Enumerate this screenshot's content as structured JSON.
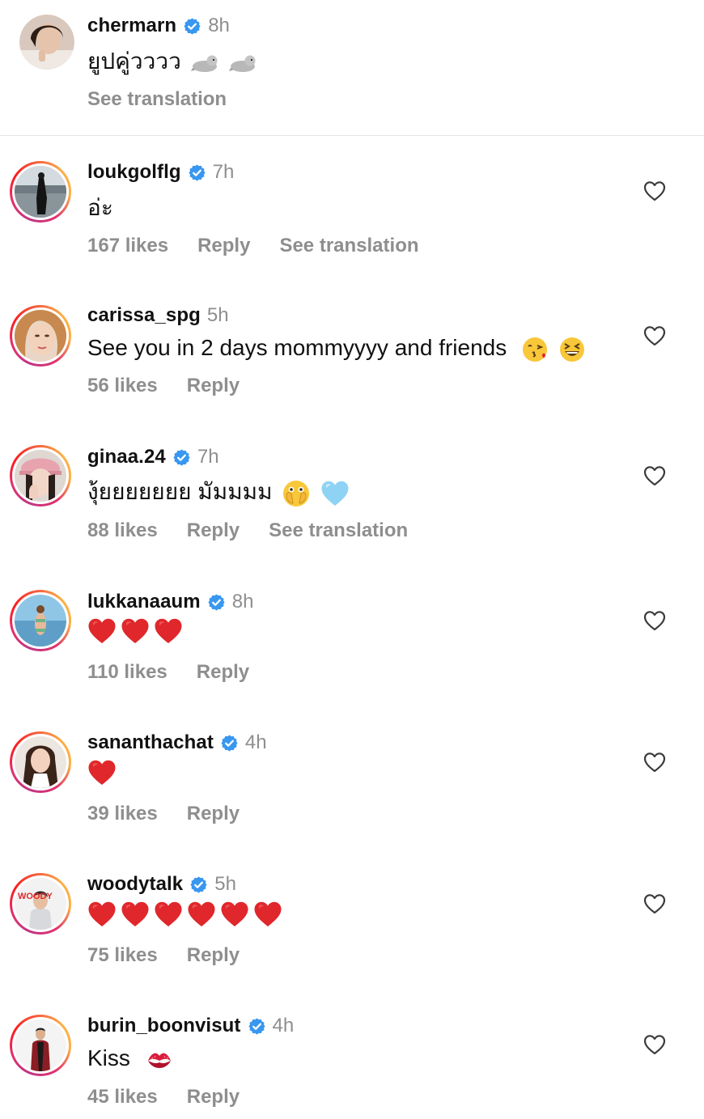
{
  "caption": {
    "username": "chermarn",
    "time": "8h",
    "text": "ยูปคู่วววว",
    "emoji": [
      "seal",
      "seal"
    ],
    "see_translation": "See translation"
  },
  "comments": [
    {
      "username": "loukgolflg",
      "verified": true,
      "time": "7h",
      "text": "อ่ะ",
      "likes": "167 likes",
      "reply": "Reply",
      "see_translation": "See translation"
    },
    {
      "username": "carissa_spg",
      "verified": false,
      "time": "5h",
      "text": "See you in 2 days mommyyyy and friends",
      "emoji": [
        "kiss-face",
        "laughing-face"
      ],
      "likes": "56 likes",
      "reply": "Reply"
    },
    {
      "username": "ginaa.24",
      "verified": true,
      "time": "7h",
      "text": "งุ้ยยยยยยย มัมมมม",
      "emoji": [
        "peeking-face",
        "light-blue-heart"
      ],
      "likes": "88 likes",
      "reply": "Reply",
      "see_translation": "See translation"
    },
    {
      "username": "lukkanaaum",
      "verified": true,
      "time": "8h",
      "emoji_count": 3,
      "likes": "110 likes",
      "reply": "Reply"
    },
    {
      "username": "sananthachat",
      "verified": true,
      "time": "4h",
      "emoji_count": 1,
      "likes": "39 likes",
      "reply": "Reply"
    },
    {
      "username": "woodytalk",
      "verified": true,
      "time": "5h",
      "emoji_count": 6,
      "likes": "75 likes",
      "reply": "Reply",
      "avatar_logo": "WOODY"
    },
    {
      "username": "burin_boonvisut",
      "verified": true,
      "time": "4h",
      "text": "Kiss",
      "emoji": [
        "kiss-mark"
      ],
      "likes": "45 likes",
      "reply": "Reply"
    }
  ],
  "colors": {
    "verified_blue": "#3897f0",
    "muted_text": "#8e8e8e",
    "heart_red": "#e0272b",
    "story_ring": [
      "#c13584",
      "#e1306c",
      "#fd1d1d",
      "#fcaf45"
    ]
  }
}
